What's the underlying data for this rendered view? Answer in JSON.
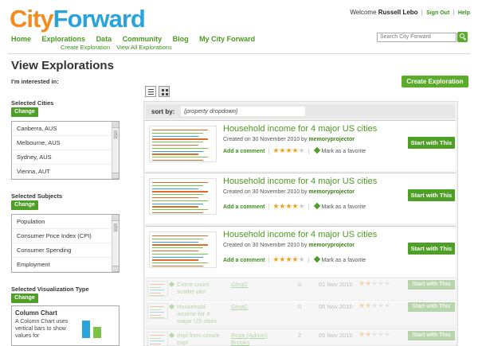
{
  "header": {
    "logo_part1": "City",
    "logo_part2": "Forward",
    "welcome_text": "Welcome",
    "user_name": "Russell Lebo",
    "sign_out": "Sign Out",
    "help": "Help",
    "search_placeholder": "Search City Forward"
  },
  "nav": {
    "items": [
      "Home",
      "Explorations",
      "Data",
      "Community",
      "Blog",
      "My City Forward"
    ],
    "sub_items": [
      "Create Exploration",
      "View All Explorations"
    ]
  },
  "page": {
    "title": "View Explorations",
    "interested_label": "I'm interested in:",
    "create_button": "Create Exploration"
  },
  "filters": {
    "cities": {
      "heading": "Selected Cities",
      "change_label": "Change",
      "items": [
        "Canberra, AUS",
        "Melbourne, AUS",
        "Sydney, AUS",
        "Vienna, AUT"
      ]
    },
    "subjects": {
      "heading": "Selected Subjects",
      "change_label": "Change",
      "items": [
        "Population",
        "Consumer Price Index (CPI)",
        "Consumer Spending",
        "Employment"
      ]
    },
    "viz_type": {
      "heading": "Selected Visualization Type",
      "change_label": "Change",
      "chart_title": "Column Chart",
      "chart_desc": "A Column Chart uses vertical bars to show values for"
    }
  },
  "sort": {
    "label": "sort by:",
    "dropdown_value": "{property dropdown}"
  },
  "cards": [
    {
      "title": "Household income for 4 major US cities",
      "meta_prefix": "Created on 30 November 2010 by",
      "author": "memoryprojector",
      "add_comment": "Add a comment",
      "rating": 4,
      "favorite": "Mark as a favorite",
      "start_label": "Start with This"
    },
    {
      "title": "Household income for 4 major US cities",
      "meta_prefix": "Created on 30 November 2010 by",
      "author": "memoryprojector",
      "add_comment": "Add a comment",
      "rating": 4,
      "favorite": "Mark as a favorite",
      "start_label": "Start with This"
    },
    {
      "title": "Household income for 4 major US cities",
      "meta_prefix": "Created on 30 November 2010 by",
      "author": "memoryprojector",
      "add_comment": "Add a comment",
      "rating": 4,
      "favorite": "Mark as a favorite",
      "start_label": "Start with This"
    }
  ],
  "rows": [
    {
      "title": "Crime count scatter plot",
      "author": "GinaC",
      "count": "0",
      "date": "01 Nov 2010",
      "rating": 2,
      "start_label": "Start with This"
    },
    {
      "title": "Household income for 4 major US cities",
      "author": "GinaC",
      "count": "0",
      "date": "05 Nov 2010",
      "rating": 2,
      "start_label": "Start with This"
    },
    {
      "title": "expl from create expl",
      "author": "Rose (Admin) Brooks",
      "count": "2",
      "date": "05 Nov 2010",
      "rating": 2,
      "start_label": "Start with This"
    }
  ],
  "colors": {
    "brand_orange": "#f28c1e",
    "brand_blue": "#2aa3d8",
    "accent_green": "#4e9f26",
    "star": "#f0a020"
  }
}
